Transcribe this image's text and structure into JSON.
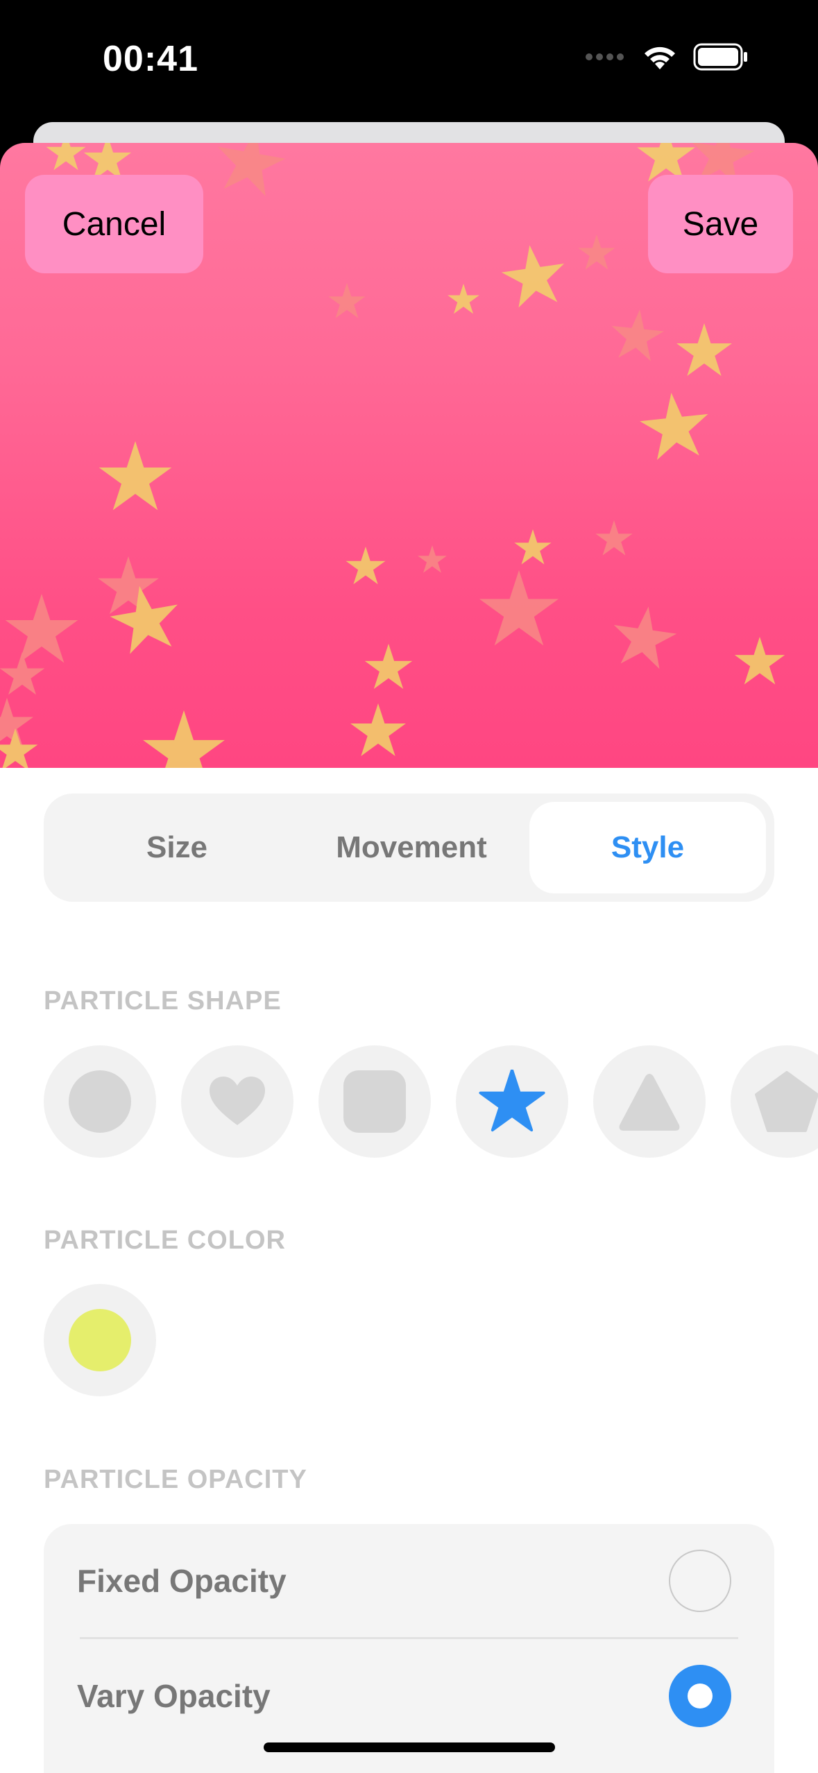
{
  "status_bar": {
    "time": "00:41"
  },
  "header": {
    "cancel_label": "Cancel",
    "save_label": "Save"
  },
  "segmented_control": {
    "tabs": [
      "Size",
      "Movement",
      "Style"
    ],
    "selected": "Style"
  },
  "particle_shape": {
    "label": "PARTICLE SHAPE",
    "options": [
      "circle-icon",
      "heart-icon",
      "rounded-square-icon",
      "star-icon",
      "triangle-icon",
      "pentagon-icon"
    ],
    "selected": "star-icon"
  },
  "particle_color": {
    "label": "PARTICLE COLOR",
    "color": "#e5ee6c"
  },
  "particle_opacity": {
    "label": "PARTICLE OPACITY",
    "options": [
      {
        "label": "Fixed Opacity",
        "selected": false
      },
      {
        "label": "Vary Opacity",
        "selected": true
      }
    ]
  },
  "colors": {
    "accent": "#2e8ff3",
    "preview_top": "#ff78a0",
    "preview_bottom": "#ff4682",
    "star_yellow": "#f1d46a",
    "star_salmon": "#f88a86"
  }
}
